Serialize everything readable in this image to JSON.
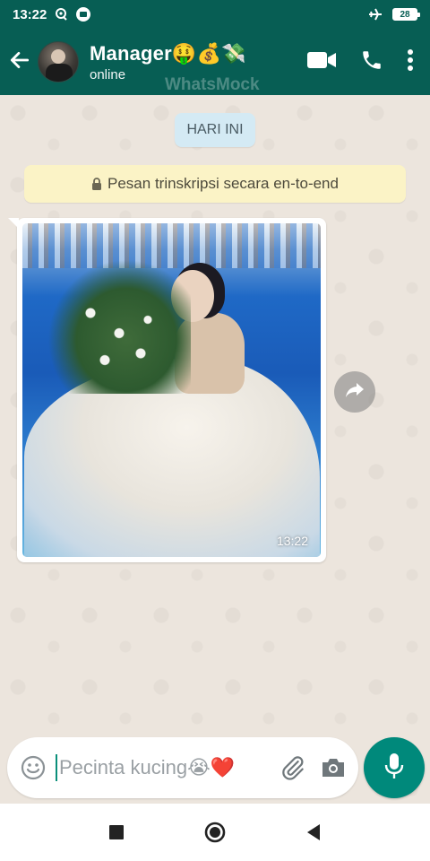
{
  "status_bar": {
    "time": "13:22",
    "battery": "28",
    "icons": [
      "location-icon",
      "media-icon",
      "airplane-mode-icon",
      "battery-icon"
    ]
  },
  "header": {
    "contact_name": "Manager🤑💰💸",
    "contact_status": "online",
    "watermark": "WhatsMock",
    "icons": [
      "back-arrow-icon",
      "video-call-icon",
      "phone-call-icon",
      "more-options-icon"
    ],
    "color": "#075E54"
  },
  "chat": {
    "date_chip": "HARI INI",
    "encryption_notice": "Pesan trinskripsi secara en-to-end",
    "image_message": {
      "time": "13:22"
    },
    "background": "#ECE5DD"
  },
  "input": {
    "value": "Pecinta kucing😭❤️",
    "icons": [
      "emoji-icon",
      "attach-icon",
      "camera-icon",
      "mic-icon"
    ],
    "accent": "#00897B"
  },
  "navbar": {
    "icons": [
      "recent-apps-icon",
      "home-icon",
      "back-icon"
    ]
  }
}
